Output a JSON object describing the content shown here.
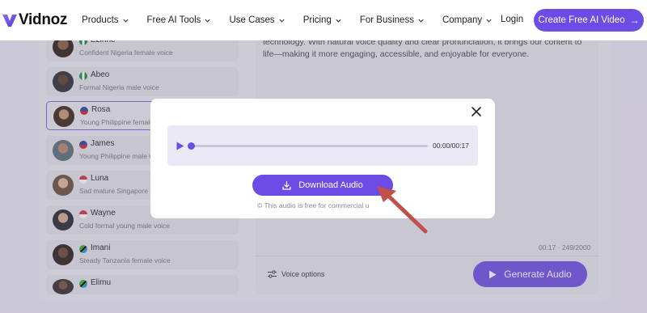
{
  "nav": {
    "logo_text": "Vidnoz",
    "menu": [
      {
        "label": "Products"
      },
      {
        "label": "Free AI Tools"
      },
      {
        "label": "Use Cases"
      },
      {
        "label": "Pricing"
      },
      {
        "label": "For Business"
      },
      {
        "label": "Company"
      }
    ],
    "login": "Login",
    "cta": "Create Free AI Video",
    "cta_arrow": "→"
  },
  "voices": [
    {
      "name": "Ezinne",
      "desc": "Confident Nigeria female voice",
      "flag": "nigeria"
    },
    {
      "name": "Abeo",
      "desc": "Formal Nigeria male voice",
      "flag": "nigeria"
    },
    {
      "name": "Rosa",
      "desc": "Young Philippine female",
      "flag": "philippines",
      "selected": true
    },
    {
      "name": "James",
      "desc": "Young Philippine male v",
      "flag": "philippines"
    },
    {
      "name": "Luna",
      "desc": "Sad mature Singapore f",
      "flag": "singapore"
    },
    {
      "name": "Wayne",
      "desc": "Cold formal young male voice",
      "flag": "singapore"
    },
    {
      "name": "Imani",
      "desc": "Steady Tanzania female voice",
      "flag": "tanzania"
    },
    {
      "name": "Elimu",
      "desc": "",
      "flag": "tanzania"
    }
  ],
  "editor": {
    "script_text": "technology. With natural voice quality and clear pronunciation, it brings our content to life—making it more engaging, accessible, and enjoyable for everyone.",
    "duration": "00:17",
    "char_count": "249/2000",
    "voice_options": "Voice options",
    "generate": "Generate Audio"
  },
  "modal": {
    "time": "00:00/00:17",
    "progress": 0,
    "download": "Download Audio",
    "note": "This audio is free for commercial u"
  },
  "colors": {
    "accent": "#6c4ce4",
    "annotation_arrow": "#c0504d"
  }
}
